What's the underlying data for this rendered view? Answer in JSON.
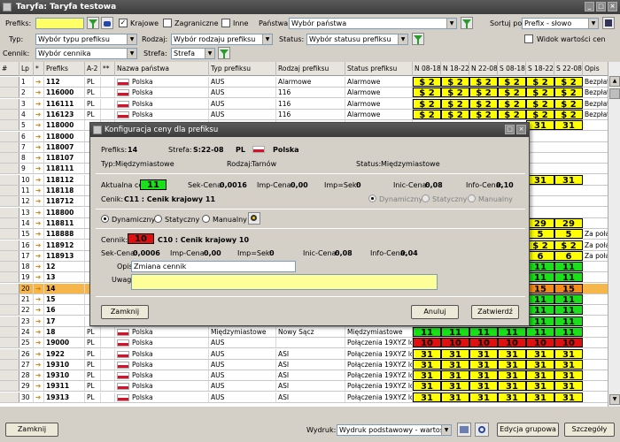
{
  "window": {
    "title": "Taryfa: Taryfa testowa"
  },
  "filters": {
    "prefix_label": "Prefiks:",
    "prefix_value": "",
    "krajowe_label": "Krajowe",
    "krajowe_checked": true,
    "zagraniczne_label": "Zagraniczne",
    "inne_label": "Inne",
    "panstwa_label": "Państwa:",
    "panstwa_value": "Wybór państwa",
    "sort_label": "Sortuj po:",
    "sort_value": "Prefix - słowo",
    "typ_label": "Typ:",
    "typ_value": "Wybór typu prefiksu",
    "rodzaj_label": "Rodzaj:",
    "rodzaj_value": "Wybór rodzaju prefiksu",
    "status_label": "Status:",
    "status_value": "Wybór statusu prefiksu",
    "widok_label": "Widok wartości cen",
    "cennik_label": "Cennik:",
    "cennik_value": "Wybór cennika",
    "strefa_label": "Strefa:",
    "strefa_value": "Strefa"
  },
  "columns": {
    "hash": "#",
    "lp": "Lp",
    "star": "*",
    "prefiks": "Prefiks",
    "a2": "A-2",
    "stars": "**",
    "nazwa": "Nazwa państwa",
    "typ": "Typ prefiksu",
    "rodzaj": "Rodzaj prefiksu",
    "status": "Status prefiksu",
    "n0818": "N 08-18",
    "n1822": "N 18-22",
    "n2208": "N 22-08",
    "s0818": "S 08-18",
    "s1822": "S 18-22",
    "s2208": "S 22-08",
    "opis": "Opis"
  },
  "rows": [
    {
      "lp": "1",
      "prefiks": "112",
      "a2": "PL",
      "nazwa": "Polska",
      "typ": "AUS",
      "rodzaj": "Alarmowe",
      "status": "Alarmowe",
      "p": [
        "$ 2",
        "$ 2",
        "$ 2",
        "$ 2",
        "$ 2",
        "$ 2"
      ],
      "pc": [
        "y",
        "y",
        "y",
        "y",
        "y",
        "y"
      ],
      "opis": "Bezpłatr"
    },
    {
      "lp": "2",
      "prefiks": "116000",
      "a2": "PL",
      "nazwa": "Polska",
      "typ": "AUS",
      "rodzaj": "116",
      "status": "Alarmowe",
      "p": [
        "$ 2",
        "$ 2",
        "$ 2",
        "$ 2",
        "$ 2",
        "$ 2"
      ],
      "pc": [
        "y",
        "y",
        "y",
        "y",
        "y",
        "y"
      ],
      "opis": "Bezpłatr"
    },
    {
      "lp": "3",
      "prefiks": "116111",
      "a2": "PL",
      "nazwa": "Polska",
      "typ": "AUS",
      "rodzaj": "116",
      "status": "Alarmowe",
      "p": [
        "$ 2",
        "$ 2",
        "$ 2",
        "$ 2",
        "$ 2",
        "$ 2"
      ],
      "pc": [
        "y",
        "y",
        "y",
        "y",
        "y",
        "y"
      ],
      "opis": "Bezpłatr"
    },
    {
      "lp": "4",
      "prefiks": "116123",
      "a2": "PL",
      "nazwa": "Polska",
      "typ": "AUS",
      "rodzaj": "116",
      "status": "Alarmowe",
      "p": [
        "$ 2",
        "$ 2",
        "$ 2",
        "$ 2",
        "$ 2",
        "$ 2"
      ],
      "pc": [
        "y",
        "y",
        "y",
        "y",
        "y",
        "y"
      ],
      "opis": "Bezpłatr"
    },
    {
      "lp": "5",
      "prefiks": "118000",
      "a2": "",
      "nazwa": "",
      "typ": "",
      "rodzaj": "",
      "status": "",
      "p": [
        "",
        "",
        "",
        "",
        "31",
        "31"
      ],
      "pc": [
        "",
        "",
        "",
        "",
        "y",
        "y"
      ],
      "opis": ""
    },
    {
      "lp": "6",
      "prefiks": "118000",
      "a2": "",
      "nazwa": "",
      "typ": "",
      "rodzaj": "",
      "status": "",
      "p": [
        "",
        "",
        "",
        "",
        "",
        ""
      ],
      "pc": [
        "",
        "",
        "",
        "",
        "",
        ""
      ],
      "opis": ""
    },
    {
      "lp": "7",
      "prefiks": "118007",
      "a2": "",
      "nazwa": "",
      "typ": "",
      "rodzaj": "",
      "status": "",
      "p": [
        "",
        "",
        "",
        "",
        "",
        ""
      ],
      "pc": [
        "",
        "",
        "",
        "",
        "",
        ""
      ],
      "opis": ""
    },
    {
      "lp": "8",
      "prefiks": "118107",
      "a2": "",
      "nazwa": "",
      "typ": "",
      "rodzaj": "",
      "status": "",
      "p": [
        "",
        "",
        "",
        "",
        "",
        ""
      ],
      "pc": [
        "",
        "",
        "",
        "",
        "",
        ""
      ],
      "opis": ""
    },
    {
      "lp": "9",
      "prefiks": "118111",
      "a2": "",
      "nazwa": "",
      "typ": "",
      "rodzaj": "",
      "status": "",
      "p": [
        "",
        "",
        "",
        "",
        "",
        ""
      ],
      "pc": [
        "",
        "",
        "",
        "",
        "",
        ""
      ],
      "opis": ""
    },
    {
      "lp": "10",
      "prefiks": "118112",
      "a2": "",
      "nazwa": "",
      "typ": "",
      "rodzaj": "",
      "status": "",
      "p": [
        "",
        "",
        "",
        "",
        "31",
        "31"
      ],
      "pc": [
        "",
        "",
        "",
        "",
        "y",
        "y"
      ],
      "opis": ""
    },
    {
      "lp": "11",
      "prefiks": "118118",
      "a2": "",
      "nazwa": "",
      "typ": "",
      "rodzaj": "",
      "status": "",
      "p": [
        "",
        "",
        "",
        "",
        "",
        ""
      ],
      "pc": [
        "",
        "",
        "",
        "",
        "",
        ""
      ],
      "opis": ""
    },
    {
      "lp": "12",
      "prefiks": "118712",
      "a2": "",
      "nazwa": "",
      "typ": "",
      "rodzaj": "",
      "status": "",
      "p": [
        "",
        "",
        "",
        "",
        "",
        ""
      ],
      "pc": [
        "",
        "",
        "",
        "",
        "",
        ""
      ],
      "opis": ""
    },
    {
      "lp": "13",
      "prefiks": "118800",
      "a2": "",
      "nazwa": "",
      "typ": "",
      "rodzaj": "",
      "status": "",
      "p": [
        "",
        "",
        "",
        "",
        "",
        ""
      ],
      "pc": [
        "",
        "",
        "",
        "",
        "",
        ""
      ],
      "opis": ""
    },
    {
      "lp": "14",
      "prefiks": "118811",
      "a2": "",
      "nazwa": "",
      "typ": "",
      "rodzaj": "",
      "status": "",
      "p": [
        "",
        "",
        "",
        "",
        "29",
        "29"
      ],
      "pc": [
        "",
        "",
        "",
        "",
        "y",
        "y"
      ],
      "opis": ""
    },
    {
      "lp": "15",
      "prefiks": "118888",
      "a2": "",
      "nazwa": "",
      "typ": "",
      "rodzaj": "",
      "status": "",
      "p": [
        "",
        "",
        "",
        "",
        "5",
        "5"
      ],
      "pc": [
        "",
        "",
        "",
        "",
        "y",
        "y"
      ],
      "opis": "Za połąc"
    },
    {
      "lp": "16",
      "prefiks": "118912",
      "a2": "",
      "nazwa": "",
      "typ": "",
      "rodzaj": "",
      "status": "",
      "p": [
        "",
        "",
        "",
        "",
        "$ 2",
        "$ 2"
      ],
      "pc": [
        "",
        "",
        "",
        "",
        "y",
        "y"
      ],
      "opis": "Za połąc"
    },
    {
      "lp": "17",
      "prefiks": "118913",
      "a2": "",
      "nazwa": "",
      "typ": "",
      "rodzaj": "",
      "status": "",
      "p": [
        "",
        "",
        "",
        "",
        "6",
        "6"
      ],
      "pc": [
        "",
        "",
        "",
        "",
        "y",
        "y"
      ],
      "opis": "Za połąc"
    },
    {
      "lp": "18",
      "prefiks": "12",
      "a2": "",
      "nazwa": "",
      "typ": "",
      "rodzaj": "",
      "status": "",
      "p": [
        "",
        "",
        "",
        "",
        "11",
        "11"
      ],
      "pc": [
        "",
        "",
        "",
        "",
        "g",
        "g"
      ],
      "opis": ""
    },
    {
      "lp": "19",
      "prefiks": "13",
      "a2": "",
      "nazwa": "",
      "typ": "",
      "rodzaj": "",
      "status": "",
      "p": [
        "",
        "",
        "",
        "",
        "11",
        "11"
      ],
      "pc": [
        "",
        "",
        "",
        "",
        "g",
        "g"
      ],
      "opis": ""
    },
    {
      "lp": "20",
      "prefiks": "14",
      "a2": "",
      "nazwa": "",
      "typ": "",
      "rodzaj": "",
      "status": "",
      "p": [
        "",
        "",
        "",
        "",
        "15",
        "15"
      ],
      "pc": [
        "",
        "",
        "",
        "",
        "o",
        "o"
      ],
      "opis": "",
      "sel": true
    },
    {
      "lp": "21",
      "prefiks": "15",
      "a2": "",
      "nazwa": "",
      "typ": "",
      "rodzaj": "",
      "status": "",
      "p": [
        "",
        "",
        "",
        "",
        "11",
        "11"
      ],
      "pc": [
        "",
        "",
        "",
        "",
        "g",
        "g"
      ],
      "opis": ""
    },
    {
      "lp": "22",
      "prefiks": "16",
      "a2": "",
      "nazwa": "",
      "typ": "",
      "rodzaj": "",
      "status": "",
      "p": [
        "",
        "",
        "",
        "",
        "11",
        "11"
      ],
      "pc": [
        "",
        "",
        "",
        "",
        "g",
        "g"
      ],
      "opis": ""
    },
    {
      "lp": "23",
      "prefiks": "17",
      "a2": "",
      "nazwa": "",
      "typ": "",
      "rodzaj": "",
      "status": "",
      "p": [
        "",
        "",
        "",
        "",
        "11",
        "11"
      ],
      "pc": [
        "",
        "",
        "",
        "",
        "g",
        "g"
      ],
      "opis": ""
    },
    {
      "lp": "24",
      "prefiks": "18",
      "a2": "PL",
      "nazwa": "Polska",
      "typ": "Międzymiastowe",
      "rodzaj": "Nowy Sącz",
      "status": "Międzymiastowe",
      "p": [
        "11",
        "11",
        "11",
        "11",
        "11",
        "11"
      ],
      "pc": [
        "g",
        "g",
        "g",
        "g",
        "g",
        "g"
      ],
      "opis": ""
    },
    {
      "lp": "25",
      "prefiks": "19000",
      "a2": "PL",
      "nazwa": "Polska",
      "typ": "AUS",
      "rodzaj": "",
      "status": "Połączenia 19XYZ loka",
      "p": [
        "10",
        "10",
        "10",
        "10",
        "10",
        "10"
      ],
      "pc": [
        "r",
        "r",
        "r",
        "r",
        "r",
        "r"
      ],
      "opis": ""
    },
    {
      "lp": "26",
      "prefiks": "1922",
      "a2": "PL",
      "nazwa": "Polska",
      "typ": "AUS",
      "rodzaj": "ASI",
      "status": "Połączenia 19XYZ loka",
      "p": [
        "31",
        "31",
        "31",
        "31",
        "31",
        "31"
      ],
      "pc": [
        "y",
        "y",
        "y",
        "y",
        "y",
        "y"
      ],
      "opis": ""
    },
    {
      "lp": "27",
      "prefiks": "19310",
      "a2": "PL",
      "nazwa": "Polska",
      "typ": "AUS",
      "rodzaj": "ASI",
      "status": "Połączenia 19XYZ loka",
      "p": [
        "31",
        "31",
        "31",
        "31",
        "31",
        "31"
      ],
      "pc": [
        "y",
        "y",
        "y",
        "y",
        "y",
        "y"
      ],
      "opis": ""
    },
    {
      "lp": "28",
      "prefiks": "19310",
      "a2": "PL",
      "nazwa": "Polska",
      "typ": "AUS",
      "rodzaj": "ASI",
      "status": "Połączenia 19XYZ loka",
      "p": [
        "31",
        "31",
        "31",
        "31",
        "31",
        "31"
      ],
      "pc": [
        "y",
        "y",
        "y",
        "y",
        "y",
        "y"
      ],
      "opis": ""
    },
    {
      "lp": "29",
      "prefiks": "19311",
      "a2": "PL",
      "nazwa": "Polska",
      "typ": "AUS",
      "rodzaj": "ASI",
      "status": "Połączenia 19XYZ loka",
      "p": [
        "31",
        "31",
        "31",
        "31",
        "31",
        "31"
      ],
      "pc": [
        "y",
        "y",
        "y",
        "y",
        "y",
        "y"
      ],
      "opis": ""
    },
    {
      "lp": "30",
      "prefiks": "19313",
      "a2": "PL",
      "nazwa": "Polska",
      "typ": "AUS",
      "rodzaj": "ASI",
      "status": "Połączenia 19XYZ loka",
      "p": [
        "31",
        "31",
        "31",
        "31",
        "31",
        "31"
      ],
      "pc": [
        "y",
        "y",
        "y",
        "y",
        "y",
        "y"
      ],
      "opis": ""
    }
  ],
  "dialog": {
    "title": "Konfiguracja ceny dla prefiksu",
    "prefiks_label": "Prefiks:",
    "prefiks_value": "14",
    "strefa_label": "Strefa:",
    "strefa_value": "S:22-08",
    "country_code": "PL",
    "country_name": "Polska",
    "typ_label": "Typ:",
    "typ_value": "Międzymiastowe",
    "rodzaj_label": "Rodzaj:",
    "rodzaj_value": "Tarnów",
    "status_label": "Status:",
    "status_value": "Międzymiastowe",
    "aktualna_label": "Aktualna cena:",
    "aktualna_value": "11",
    "sek_label": "Sek-Cena:",
    "sek_value": "0,0016",
    "imp_label": "Imp-Cena:",
    "imp_value": "0,00",
    "impsek_label": "Imp=Sek:",
    "impsek_value": "0",
    "inic_label": "Inic-Cena:",
    "inic_value": "0,08",
    "info_label": "Info-Cena:",
    "info_value": "0,10",
    "cenik_label": "Cenik:",
    "cenik_value": "C11 : Cenik krajowy 11",
    "dyn_label": "Dynamiczny",
    "stat_label": "Statyczny",
    "man_label": "Manualny",
    "cennik_label": "Cennik:",
    "cennik_badge": "10",
    "cennik_desc": "C10 : Cenik krajowy 10",
    "sek2_value": "0,0006",
    "imp2_value": "0,00",
    "impsek2_value": "0",
    "inic2_value": "0,08",
    "info2_value": "0,04",
    "opis_label": "Opis:",
    "opis_value": "Zmiana cennik",
    "uwagi_label": "Uwagi:",
    "uwagi_value": "",
    "zamknij": "Zamknij",
    "anuluj": "Anuluj",
    "zatwierdz": "Zatwierdź"
  },
  "footer": {
    "zamknij": "Zamknij",
    "wydruk_label": "Wydruk:",
    "wydruk_value": "Wydruk podstawowy - wartość",
    "edycja": "Edycja grupowa",
    "szczegoly": "Szczegóły"
  }
}
